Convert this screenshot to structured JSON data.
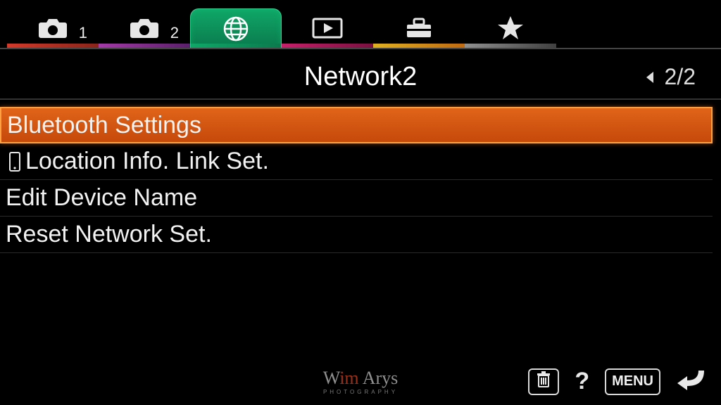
{
  "tabs": [
    {
      "name": "camera1",
      "sub": "1"
    },
    {
      "name": "camera2",
      "sub": "2"
    },
    {
      "name": "network",
      "sub": ""
    },
    {
      "name": "playback",
      "sub": ""
    },
    {
      "name": "setup",
      "sub": ""
    },
    {
      "name": "favorite",
      "sub": ""
    }
  ],
  "page": {
    "title": "Network2",
    "index": "2/2"
  },
  "menu": {
    "items": [
      {
        "label": "Bluetooth Settings",
        "selected": true,
        "hasPhoneIcon": false
      },
      {
        "label": "Location Info. Link Set.",
        "selected": false,
        "hasPhoneIcon": true
      },
      {
        "label": "Edit Device Name",
        "selected": false,
        "hasPhoneIcon": false
      },
      {
        "label": "Reset Network Set.",
        "selected": false,
        "hasPhoneIcon": false
      }
    ]
  },
  "footer": {
    "menu_label": "MENU"
  },
  "watermark": {
    "line1_a": "W",
    "line1_b": "im",
    "line1_c": " Arys",
    "line2": "PHOTOGRAPHY"
  }
}
